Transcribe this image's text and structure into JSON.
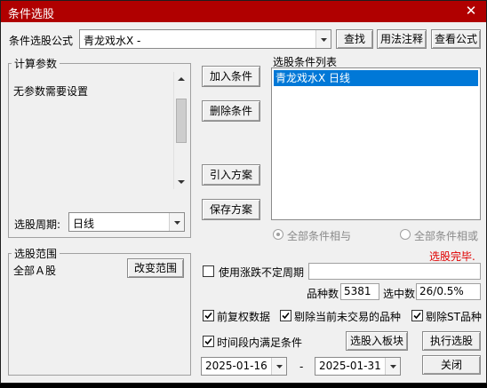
{
  "window": {
    "title": "条件选股",
    "close_glyph": "✕"
  },
  "formula": {
    "label": "条件选股公式",
    "value": "青龙戏水X   -"
  },
  "buttons": {
    "find": "查找",
    "usage": "用法注释",
    "view_formula": "查看公式",
    "add_condition": "加入条件",
    "delete_condition": "删除条件",
    "import_plan": "引入方案",
    "save_plan": "保存方案",
    "change_range": "改变范围",
    "add_to_block": "选股入板块",
    "execute": "执行选股",
    "close": "关闭"
  },
  "params": {
    "group_title": "计算参数",
    "message": "无参数需要设置"
  },
  "period": {
    "label": "选股周期:",
    "value": "日线"
  },
  "conditions": {
    "title": "选股条件列表",
    "items": [
      "青龙戏水X  日线"
    ]
  },
  "logic": {
    "and_label": "全部条件相与",
    "or_label": "全部条件相或",
    "selected": "and"
  },
  "status": {
    "text": "选股完毕.",
    "color": "#e00000"
  },
  "range": {
    "group_title": "选股范围",
    "value": "全部Ａ股"
  },
  "uncertain_period": {
    "label": "使用涨跌不定周期",
    "checked": false,
    "value": ""
  },
  "counts": {
    "total_label": "品种数",
    "total_value": "5381",
    "selected_label": "选中数",
    "selected_value": "26/0.5%"
  },
  "options": {
    "adjusted": {
      "label": "前复权数据",
      "checked": true
    },
    "exclude_untraded": {
      "label": "剔除当前未交易的品种",
      "checked": true
    },
    "exclude_st": {
      "label": "剔除ST品种",
      "checked": true
    },
    "time_range": {
      "label": "时间段内满足条件",
      "checked": true
    }
  },
  "dates": {
    "start": "2025-01-16",
    "separator": "-",
    "end": "2025-01-31"
  }
}
